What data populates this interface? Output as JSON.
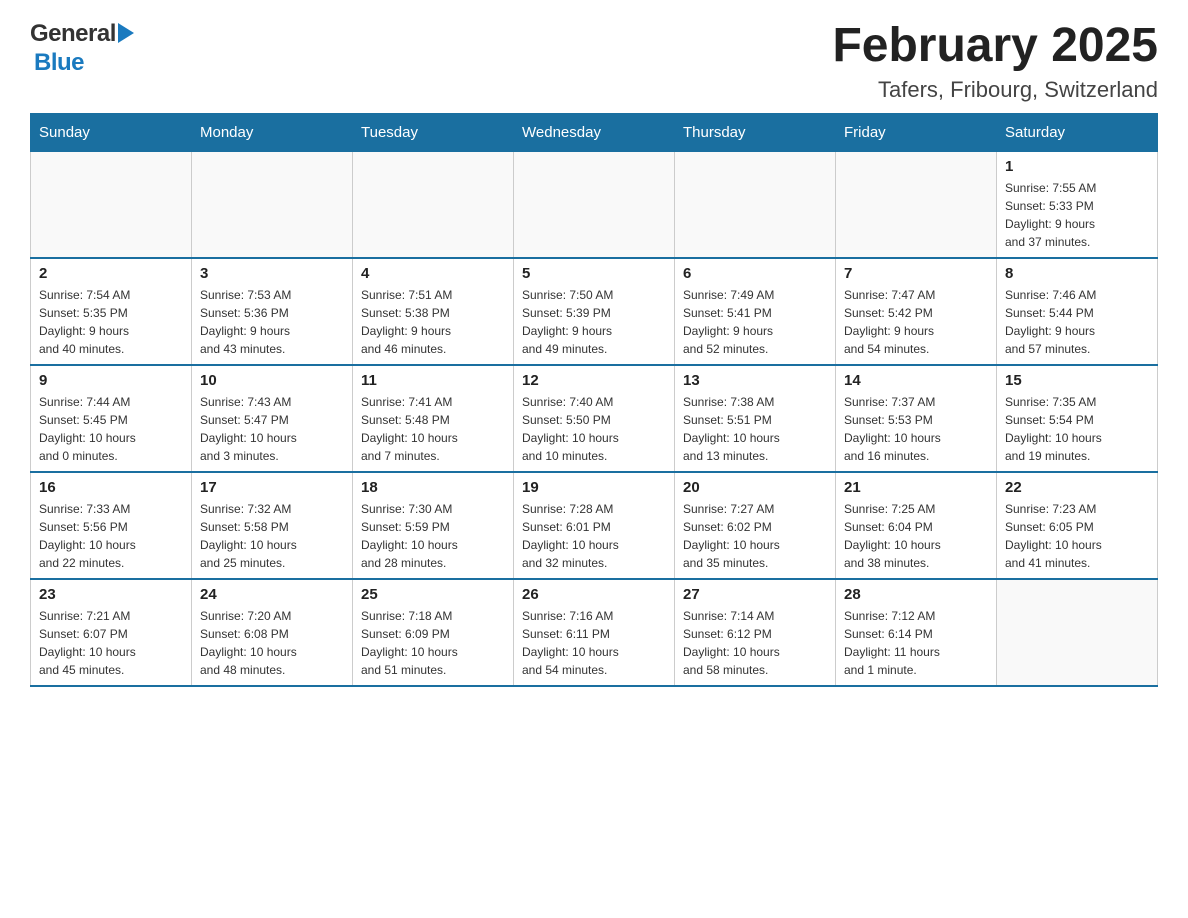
{
  "header": {
    "title": "February 2025",
    "location": "Tafers, Fribourg, Switzerland",
    "logo_general": "General",
    "logo_blue": "Blue"
  },
  "days_of_week": [
    "Sunday",
    "Monday",
    "Tuesday",
    "Wednesday",
    "Thursday",
    "Friday",
    "Saturday"
  ],
  "weeks": [
    {
      "days": [
        {
          "number": "",
          "info": ""
        },
        {
          "number": "",
          "info": ""
        },
        {
          "number": "",
          "info": ""
        },
        {
          "number": "",
          "info": ""
        },
        {
          "number": "",
          "info": ""
        },
        {
          "number": "",
          "info": ""
        },
        {
          "number": "1",
          "info": "Sunrise: 7:55 AM\nSunset: 5:33 PM\nDaylight: 9 hours\nand 37 minutes."
        }
      ]
    },
    {
      "days": [
        {
          "number": "2",
          "info": "Sunrise: 7:54 AM\nSunset: 5:35 PM\nDaylight: 9 hours\nand 40 minutes."
        },
        {
          "number": "3",
          "info": "Sunrise: 7:53 AM\nSunset: 5:36 PM\nDaylight: 9 hours\nand 43 minutes."
        },
        {
          "number": "4",
          "info": "Sunrise: 7:51 AM\nSunset: 5:38 PM\nDaylight: 9 hours\nand 46 minutes."
        },
        {
          "number": "5",
          "info": "Sunrise: 7:50 AM\nSunset: 5:39 PM\nDaylight: 9 hours\nand 49 minutes."
        },
        {
          "number": "6",
          "info": "Sunrise: 7:49 AM\nSunset: 5:41 PM\nDaylight: 9 hours\nand 52 minutes."
        },
        {
          "number": "7",
          "info": "Sunrise: 7:47 AM\nSunset: 5:42 PM\nDaylight: 9 hours\nand 54 minutes."
        },
        {
          "number": "8",
          "info": "Sunrise: 7:46 AM\nSunset: 5:44 PM\nDaylight: 9 hours\nand 57 minutes."
        }
      ]
    },
    {
      "days": [
        {
          "number": "9",
          "info": "Sunrise: 7:44 AM\nSunset: 5:45 PM\nDaylight: 10 hours\nand 0 minutes."
        },
        {
          "number": "10",
          "info": "Sunrise: 7:43 AM\nSunset: 5:47 PM\nDaylight: 10 hours\nand 3 minutes."
        },
        {
          "number": "11",
          "info": "Sunrise: 7:41 AM\nSunset: 5:48 PM\nDaylight: 10 hours\nand 7 minutes."
        },
        {
          "number": "12",
          "info": "Sunrise: 7:40 AM\nSunset: 5:50 PM\nDaylight: 10 hours\nand 10 minutes."
        },
        {
          "number": "13",
          "info": "Sunrise: 7:38 AM\nSunset: 5:51 PM\nDaylight: 10 hours\nand 13 minutes."
        },
        {
          "number": "14",
          "info": "Sunrise: 7:37 AM\nSunset: 5:53 PM\nDaylight: 10 hours\nand 16 minutes."
        },
        {
          "number": "15",
          "info": "Sunrise: 7:35 AM\nSunset: 5:54 PM\nDaylight: 10 hours\nand 19 minutes."
        }
      ]
    },
    {
      "days": [
        {
          "number": "16",
          "info": "Sunrise: 7:33 AM\nSunset: 5:56 PM\nDaylight: 10 hours\nand 22 minutes."
        },
        {
          "number": "17",
          "info": "Sunrise: 7:32 AM\nSunset: 5:58 PM\nDaylight: 10 hours\nand 25 minutes."
        },
        {
          "number": "18",
          "info": "Sunrise: 7:30 AM\nSunset: 5:59 PM\nDaylight: 10 hours\nand 28 minutes."
        },
        {
          "number": "19",
          "info": "Sunrise: 7:28 AM\nSunset: 6:01 PM\nDaylight: 10 hours\nand 32 minutes."
        },
        {
          "number": "20",
          "info": "Sunrise: 7:27 AM\nSunset: 6:02 PM\nDaylight: 10 hours\nand 35 minutes."
        },
        {
          "number": "21",
          "info": "Sunrise: 7:25 AM\nSunset: 6:04 PM\nDaylight: 10 hours\nand 38 minutes."
        },
        {
          "number": "22",
          "info": "Sunrise: 7:23 AM\nSunset: 6:05 PM\nDaylight: 10 hours\nand 41 minutes."
        }
      ]
    },
    {
      "days": [
        {
          "number": "23",
          "info": "Sunrise: 7:21 AM\nSunset: 6:07 PM\nDaylight: 10 hours\nand 45 minutes."
        },
        {
          "number": "24",
          "info": "Sunrise: 7:20 AM\nSunset: 6:08 PM\nDaylight: 10 hours\nand 48 minutes."
        },
        {
          "number": "25",
          "info": "Sunrise: 7:18 AM\nSunset: 6:09 PM\nDaylight: 10 hours\nand 51 minutes."
        },
        {
          "number": "26",
          "info": "Sunrise: 7:16 AM\nSunset: 6:11 PM\nDaylight: 10 hours\nand 54 minutes."
        },
        {
          "number": "27",
          "info": "Sunrise: 7:14 AM\nSunset: 6:12 PM\nDaylight: 10 hours\nand 58 minutes."
        },
        {
          "number": "28",
          "info": "Sunrise: 7:12 AM\nSunset: 6:14 PM\nDaylight: 11 hours\nand 1 minute."
        },
        {
          "number": "",
          "info": ""
        }
      ]
    }
  ]
}
